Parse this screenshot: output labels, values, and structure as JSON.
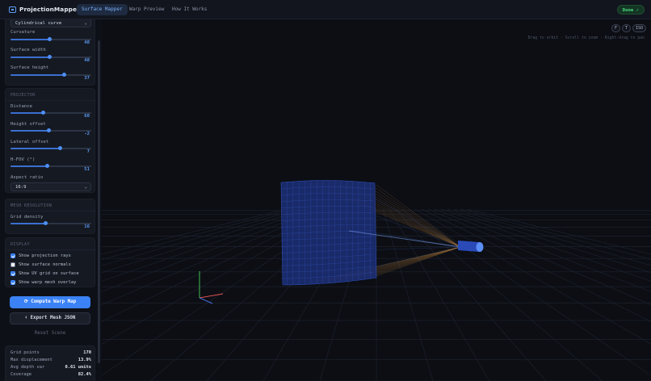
{
  "app": {
    "name": "ProjectionMapper",
    "done_label": "Done ✓"
  },
  "nav": {
    "tabs": [
      "Surface Mapper",
      "Warp Preview",
      "How It Works"
    ],
    "active": 0
  },
  "surface": {
    "shape_value": "Cylindrical curve",
    "controls": [
      {
        "label": "Curvature",
        "value": "48",
        "fraction": 0.48
      },
      {
        "label": "Surface width",
        "value": "48",
        "fraction": 0.48
      },
      {
        "label": "Surface height",
        "value": "37",
        "fraction": 0.66
      }
    ]
  },
  "projector": {
    "title": "PROJECTOR",
    "controls": [
      {
        "label": "Distance",
        "value": "60",
        "fraction": 0.4
      },
      {
        "label": "Height offset",
        "value": "-2",
        "fraction": 0.47
      },
      {
        "label": "Lateral offset",
        "value": "7",
        "fraction": 0.61
      },
      {
        "label": "H-FOV (°)",
        "value": "51",
        "fraction": 0.45
      }
    ],
    "aspect_label": "Aspect ratio",
    "aspect_value": "16:9"
  },
  "mesh": {
    "title": "MESH RESOLUTION",
    "controls": [
      {
        "label": "Grid density",
        "value": "16",
        "fraction": 0.43
      }
    ]
  },
  "display": {
    "title": "DISPLAY",
    "options": [
      {
        "label": "Show projection rays",
        "checked": true
      },
      {
        "label": "Show surface normals",
        "checked": false
      },
      {
        "label": "Show UV grid on surface",
        "checked": true
      },
      {
        "label": "Show warp mesh overlay",
        "checked": true
      }
    ]
  },
  "actions": {
    "compute": "⟳ Compute Warp Map",
    "export": "⬇ Export Mesh JSON",
    "reset": "Reset Scene"
  },
  "stats": [
    {
      "label": "Grid points",
      "value": "170"
    },
    {
      "label": "Max displacement",
      "value": "13.9%"
    },
    {
      "label": "Avg depth var",
      "value": "0.61 units"
    },
    {
      "label": "Coverage",
      "value": "82.4%"
    }
  ],
  "viewport": {
    "view_buttons": [
      "F",
      "T",
      "ISO"
    ],
    "hint": "Drag to orbit · Scroll to zoom · Right-drag to pan",
    "colors": {
      "accent": "#3b82f6",
      "surface": "#1e3a8a",
      "projector": "#3b5bdb",
      "ray": "#c8873a",
      "success": "#4ade80"
    }
  }
}
